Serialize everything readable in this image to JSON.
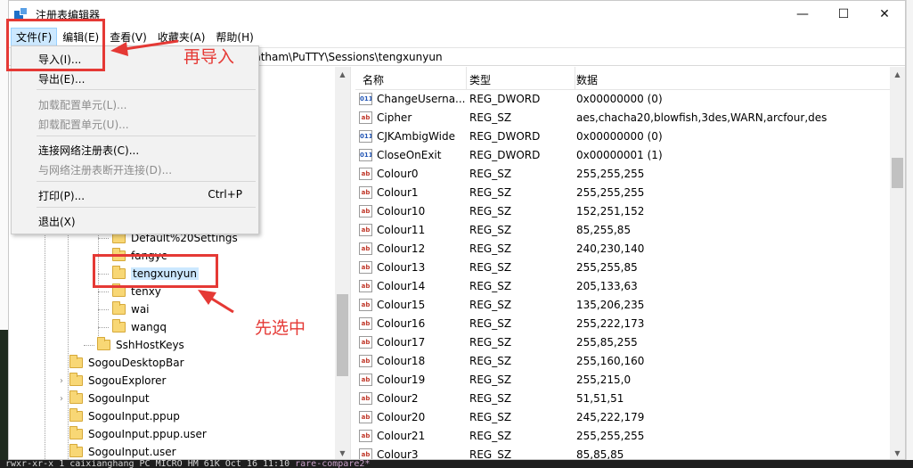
{
  "window": {
    "title": "注册表编辑器",
    "controls": {
      "minimize": "—",
      "maximize": "☐",
      "close": "✕"
    }
  },
  "menubar": [
    {
      "label": "文件(F)",
      "active": true
    },
    {
      "label": "编辑(E)"
    },
    {
      "label": "查看(V)"
    },
    {
      "label": "收藏夹(A)"
    },
    {
      "label": "帮助(H)"
    }
  ],
  "address": "Tatham\\PuTTY\\Sessions\\tengxunyun",
  "file_menu": {
    "items": [
      {
        "label": "导入(I)...",
        "enabled": true
      },
      {
        "label": "导出(E)...",
        "enabled": true
      },
      {
        "label": "加载配置单元(L)...",
        "enabled": false
      },
      {
        "label": "卸载配置单元(U)...",
        "enabled": false
      },
      {
        "label": "连接网络注册表(C)...",
        "enabled": true
      },
      {
        "label": "与网络注册表断开连接(D)...",
        "enabled": false
      },
      {
        "label": "打印(P)...",
        "enabled": true,
        "shortcut": "Ctrl+P"
      },
      {
        "label": "退出(X)",
        "enabled": true
      }
    ]
  },
  "tree": {
    "items": [
      {
        "label": "Default%20Settings"
      },
      {
        "label": "fangyc"
      },
      {
        "label": "tengxunyun",
        "selected": true
      },
      {
        "label": "tenxy"
      },
      {
        "label": "wai"
      },
      {
        "label": "wangq"
      },
      {
        "label": "SshHostKeys"
      },
      {
        "label": "SogouDesktopBar"
      },
      {
        "label": "SogouExplorer",
        "expandable": true
      },
      {
        "label": "SogouInput",
        "expandable": true
      },
      {
        "label": "SogouInput.ppup"
      },
      {
        "label": "SogouInput.ppup.user"
      },
      {
        "label": "SogouInput.user"
      }
    ]
  },
  "list": {
    "columns": [
      "名称",
      "类型",
      "数据"
    ],
    "rows": [
      {
        "icon": "dword",
        "name": "ChangeUserna...",
        "type": "REG_DWORD",
        "data": "0x00000000 (0)"
      },
      {
        "icon": "sz",
        "name": "Cipher",
        "type": "REG_SZ",
        "data": "aes,chacha20,blowfish,3des,WARN,arcfour,des"
      },
      {
        "icon": "dword",
        "name": "CJKAmbigWide",
        "type": "REG_DWORD",
        "data": "0x00000000 (0)"
      },
      {
        "icon": "dword",
        "name": "CloseOnExit",
        "type": "REG_DWORD",
        "data": "0x00000001 (1)"
      },
      {
        "icon": "sz",
        "name": "Colour0",
        "type": "REG_SZ",
        "data": "255,255,255"
      },
      {
        "icon": "sz",
        "name": "Colour1",
        "type": "REG_SZ",
        "data": "255,255,255"
      },
      {
        "icon": "sz",
        "name": "Colour10",
        "type": "REG_SZ",
        "data": "152,251,152"
      },
      {
        "icon": "sz",
        "name": "Colour11",
        "type": "REG_SZ",
        "data": "85,255,85"
      },
      {
        "icon": "sz",
        "name": "Colour12",
        "type": "REG_SZ",
        "data": "240,230,140"
      },
      {
        "icon": "sz",
        "name": "Colour13",
        "type": "REG_SZ",
        "data": "255,255,85"
      },
      {
        "icon": "sz",
        "name": "Colour14",
        "type": "REG_SZ",
        "data": "205,133,63"
      },
      {
        "icon": "sz",
        "name": "Colour15",
        "type": "REG_SZ",
        "data": "135,206,235"
      },
      {
        "icon": "sz",
        "name": "Colour16",
        "type": "REG_SZ",
        "data": "255,222,173"
      },
      {
        "icon": "sz",
        "name": "Colour17",
        "type": "REG_SZ",
        "data": "255,85,255"
      },
      {
        "icon": "sz",
        "name": "Colour18",
        "type": "REG_SZ",
        "data": "255,160,160"
      },
      {
        "icon": "sz",
        "name": "Colour19",
        "type": "REG_SZ",
        "data": "255,215,0"
      },
      {
        "icon": "sz",
        "name": "Colour2",
        "type": "REG_SZ",
        "data": "51,51,51"
      },
      {
        "icon": "sz",
        "name": "Colour20",
        "type": "REG_SZ",
        "data": "245,222,179"
      },
      {
        "icon": "sz",
        "name": "Colour21",
        "type": "REG_SZ",
        "data": "255,255,255"
      },
      {
        "icon": "sz",
        "name": "Colour3",
        "type": "REG_SZ",
        "data": "85,85,85"
      }
    ]
  },
  "icon_text": {
    "sz": "ab",
    "dword": "011"
  },
  "annotations": {
    "import_note": "再导入",
    "select_note": "先选中"
  },
  "terminal_line": {
    "text": "rwxr-xr-x 1 caixianghang PC MICRO HM 61K Oct 16 11:10 ",
    "highlight": "rare-compare2*"
  },
  "colors": {
    "accent": "#e53935",
    "selection": "#cce8ff"
  }
}
